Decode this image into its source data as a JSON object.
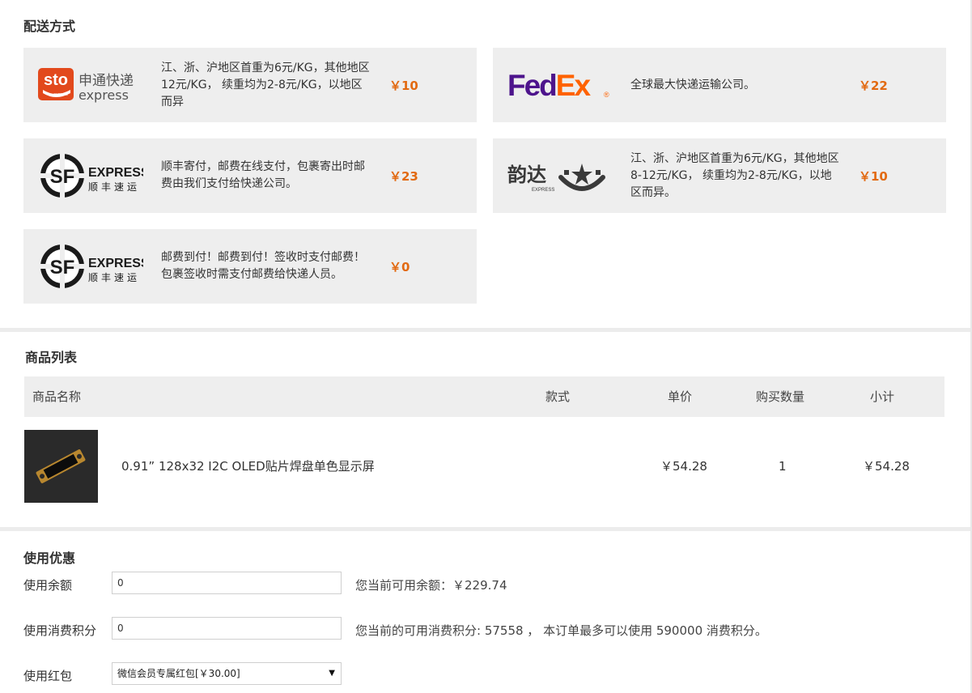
{
  "shipping": {
    "title": "配送方式",
    "options": [
      {
        "logo": "sto-express-logo",
        "logo_text_cn": "申通快递",
        "logo_text_en": "express",
        "logo_badge": "sto",
        "logo_badge_sub": "express",
        "description": "江、浙、沪地区首重为6元/KG，其他地区12元/KG， 续重均为2-8元/KG，以地区而异",
        "price": "￥10"
      },
      {
        "logo": "fedex-logo",
        "logo_text_fed": "Fed",
        "logo_text_ex": "Ex",
        "logo_reg": "®",
        "description": "全球最大快递运输公司。",
        "price": "￥22"
      },
      {
        "logo": "sf-express-logo",
        "logo_text_en": "EXPRESS",
        "logo_text_cn": "顺丰速运",
        "description": "顺丰寄付，邮费在线支付，包裹寄出时邮费由我们支付给快递公司。",
        "price": "￥23"
      },
      {
        "logo": "yunda-express-logo",
        "logo_text_cn": "韵达",
        "logo_text_en": "EXPRESS",
        "description": "江、浙、沪地区首重为6元/KG，其他地区8-12元/KG， 续重均为2-8元/KG，以地区而异。",
        "price": "￥10"
      },
      {
        "logo": "sf-express-logo",
        "logo_text_en": "EXPRESS",
        "logo_text_cn": "顺丰速运",
        "description": "邮费到付！邮费到付！签收时支付邮费！包裹签收时需支付邮费给快递人员。",
        "price": "￥0"
      }
    ]
  },
  "goods": {
    "title": "商品列表",
    "columns": {
      "name": "商品名称",
      "style": "款式",
      "unit_price": "单价",
      "quantity": "购买数量",
      "subtotal": "小计"
    },
    "items": [
      {
        "name": "0.91” 128x32 I2C OLED贴片焊盘单色显示屏",
        "style": "",
        "unit_price": "￥54.28",
        "quantity": "1",
        "subtotal": "￥54.28"
      }
    ]
  },
  "discount": {
    "title": "使用优惠",
    "balance": {
      "label": "使用余额",
      "value": "0",
      "note": "您当前可用余额：￥229.74"
    },
    "points": {
      "label": "使用消费积分",
      "value": "0",
      "note": "您当前的可用消费积分: 57558 ， 本订单最多可以使用 590000 消费积分。"
    },
    "coupon": {
      "label": "使用红包",
      "selected": "微信会员专属红包[￥30.00]"
    }
  },
  "colors": {
    "price": "#e26a12",
    "card_bg": "#eeeeee",
    "fedex_purple": "#4d148c",
    "fedex_orange": "#ff6200",
    "sto_orange": "#e2491c"
  }
}
